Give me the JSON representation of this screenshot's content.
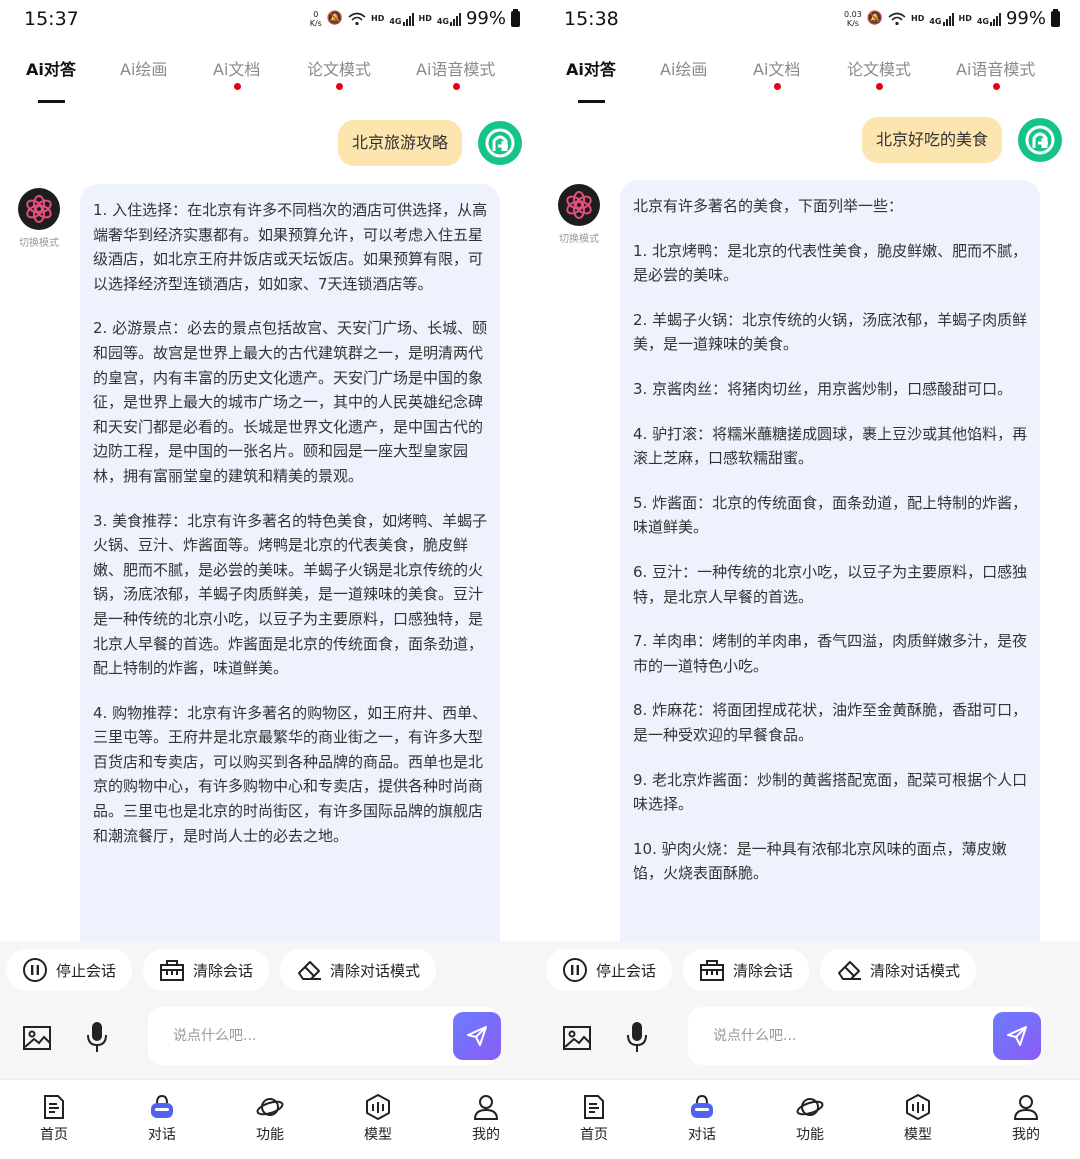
{
  "screens": [
    {
      "status": {
        "time": "15:37",
        "net_speed_top": "0",
        "net_speed_unit": "K/s",
        "hd": "HD",
        "lte": "4G",
        "battery": "99%"
      },
      "tabs": [
        {
          "label": "Ai对答",
          "active": true,
          "dot": false
        },
        {
          "label": "Ai绘画",
          "active": false,
          "dot": false
        },
        {
          "label": "Ai文档",
          "active": false,
          "dot": true
        },
        {
          "label": "论文模式",
          "active": false,
          "dot": true
        },
        {
          "label": "Ai语音模式",
          "active": false,
          "dot": true
        }
      ],
      "user_message": "北京旅游攻略",
      "bot_mode_label": "切换模式",
      "answer_paragraphs": [
        "1. 入住选择：在北京有许多不同档次的酒店可供选择，从高端奢华到经济实惠都有。如果预算允许，可以考虑入住五星级酒店，如北京王府井饭店或天坛饭店。如果预算有限，可以选择经济型连锁酒店，如如家、7天连锁酒店等。",
        "2. 必游景点：必去的景点包括故宫、天安门广场、长城、颐和园等。故宫是世界上最大的古代建筑群之一，是明清两代的皇宫，内有丰富的历史文化遗产。天安门广场是中国的象征，是世界上最大的城市广场之一，其中的人民英雄纪念碑和天安门都是必看的。长城是世界文化遗产，是中国古代的边防工程，是中国的一张名片。颐和园是一座大型皇家园林，拥有富丽堂皇的建筑和精美的景观。",
        "3. 美食推荐：北京有许多著名的特色美食，如烤鸭、羊蝎子火锅、豆汁、炸酱面等。烤鸭是北京的代表美食，脆皮鲜嫩、肥而不腻，是必尝的美味。羊蝎子火锅是北京传统的火锅，汤底浓郁，羊蝎子肉质鲜美，是一道辣味的美食。豆汁是一种传统的北京小吃，以豆子为主要原料，口感独特，是北京人早餐的首选。炸酱面是北京的传统面食，面条劲道，配上特制的炸酱，味道鲜美。",
        "4. 购物推荐：北京有许多著名的购物区，如王府井、西单、三里屯等。王府井是北京最繁华的商业街之一，有许多大型百货店和专卖店，可以购买到各种品牌的商品。西单也是北京的购物中心，有许多购物中心和专卖店，提供各种时尚商品。三里屯也是北京的时尚街区，有许多国际品牌的旗舰店和潮流餐厅，是时尚人士的必去之地。"
      ],
      "actions": [
        "停止会话",
        "清除会话",
        "清除对话模式"
      ],
      "input_placeholder": "说点什么吧...",
      "nav": [
        "首页",
        "对话",
        "功能",
        "模型",
        "我的"
      ]
    },
    {
      "status": {
        "time": "15:38",
        "net_speed_top": "0.03",
        "net_speed_unit": "K/s",
        "hd": "HD",
        "lte": "4G",
        "battery": "99%"
      },
      "tabs": [
        {
          "label": "Ai对答",
          "active": true,
          "dot": false
        },
        {
          "label": "Ai绘画",
          "active": false,
          "dot": false
        },
        {
          "label": "Ai文档",
          "active": false,
          "dot": true
        },
        {
          "label": "论文模式",
          "active": false,
          "dot": true
        },
        {
          "label": "Ai语音模式",
          "active": false,
          "dot": true
        }
      ],
      "user_message": "北京好吃的美食",
      "bot_mode_label": "切换模式",
      "answer_paragraphs": [
        "北京有许多著名的美食，下面列举一些：",
        "1. 北京烤鸭：是北京的代表性美食，脆皮鲜嫩、肥而不腻，是必尝的美味。",
        "2. 羊蝎子火锅：北京传统的火锅，汤底浓郁，羊蝎子肉质鲜美，是一道辣味的美食。",
        "3. 京酱肉丝：将猪肉切丝，用京酱炒制，口感酸甜可口。",
        "4. 驴打滚：将糯米蘸糖搓成圆球，裹上豆沙或其他馅料，再滚上芝麻，口感软糯甜蜜。",
        "5. 炸酱面：北京的传统面食，面条劲道，配上特制的炸酱，味道鲜美。",
        "6. 豆汁：一种传统的北京小吃，以豆子为主要原料，口感独特，是北京人早餐的首选。",
        "7. 羊肉串：烤制的羊肉串，香气四溢，肉质鲜嫩多汁，是夜市的一道特色小吃。",
        "8. 炸麻花：将面团捏成花状，油炸至金黄酥脆，香甜可口，是一种受欢迎的早餐食品。",
        "9. 老北京炸酱面：炒制的黄酱搭配宽面，配菜可根据个人口味选择。",
        "10. 驴肉火烧：是一种具有浓郁北京风味的面点，薄皮嫩馅，火烧表面酥脆。"
      ],
      "actions": [
        "停止会话",
        "清除会话",
        "清除对话模式"
      ],
      "input_placeholder": "说点什么吧...",
      "nav": [
        "首页",
        "对话",
        "功能",
        "模型",
        "我的"
      ]
    }
  ],
  "colors": {
    "accent": "#6c7cff",
    "user_bubble": "#fde5b0",
    "answer_bg": "#eef2fd",
    "dot": "#e60012",
    "avatar": "#16c48a"
  }
}
